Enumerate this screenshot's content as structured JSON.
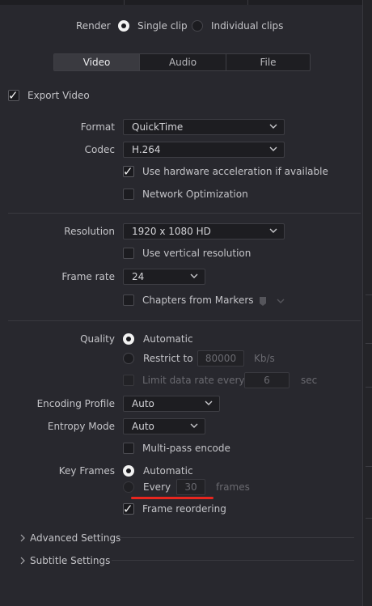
{
  "render": {
    "label": "Render",
    "options": [
      "Single clip",
      "Individual clips"
    ],
    "selected": "Single clip"
  },
  "tabs": [
    "Video",
    "Audio",
    "File"
  ],
  "active_tab": "Video",
  "export_video": {
    "label": "Export Video",
    "checked": true
  },
  "format": {
    "label": "Format",
    "value": "QuickTime"
  },
  "codec": {
    "label": "Codec",
    "value": "H.264"
  },
  "hw_accel": {
    "label": "Use hardware acceleration if available",
    "checked": true
  },
  "network_opt": {
    "label": "Network Optimization",
    "checked": false
  },
  "resolution": {
    "label": "Resolution",
    "value": "1920 x 1080 HD"
  },
  "vertical_res": {
    "label": "Use vertical resolution",
    "checked": false
  },
  "frame_rate": {
    "label": "Frame rate",
    "value": "24"
  },
  "chapters": {
    "label": "Chapters from Markers",
    "checked": false
  },
  "quality": {
    "label": "Quality",
    "automatic": "Automatic",
    "restrict_to": "Restrict to",
    "restrict_value": "80000",
    "restrict_unit": "Kb/s",
    "limit_label": "Limit data rate every",
    "limit_value": "6",
    "limit_unit": "sec",
    "selected": "Automatic"
  },
  "encoding_profile": {
    "label": "Encoding Profile",
    "value": "Auto"
  },
  "entropy_mode": {
    "label": "Entropy Mode",
    "value": "Auto"
  },
  "multipass": {
    "label": "Multi-pass encode",
    "checked": false
  },
  "key_frames": {
    "label": "Key Frames",
    "automatic": "Automatic",
    "every": "Every",
    "every_value": "30",
    "every_unit": "frames",
    "selected": "Automatic"
  },
  "frame_reordering": {
    "label": "Frame reordering",
    "checked": true
  },
  "sections": [
    "Advanced Settings",
    "Subtitle Settings"
  ],
  "colors": {
    "background": "#28282e",
    "annotation": "#e8261f",
    "active_tab": "#3a3a40"
  }
}
